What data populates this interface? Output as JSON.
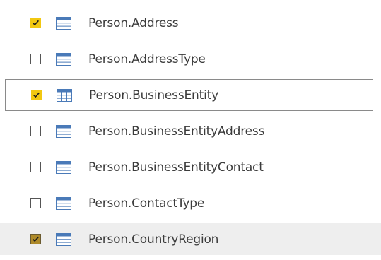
{
  "tables": [
    {
      "label": "Person.Address",
      "checked": true,
      "state": "normal"
    },
    {
      "label": "Person.AddressType",
      "checked": false,
      "state": "normal"
    },
    {
      "label": "Person.BusinessEntity",
      "checked": true,
      "state": "selected"
    },
    {
      "label": "Person.BusinessEntityAddress",
      "checked": false,
      "state": "normal"
    },
    {
      "label": "Person.BusinessEntityContact",
      "checked": false,
      "state": "normal"
    },
    {
      "label": "Person.ContactType",
      "checked": false,
      "state": "normal"
    },
    {
      "label": "Person.CountryRegion",
      "checked": true,
      "state": "hover"
    }
  ],
  "colors": {
    "check_fill": "#f2c811",
    "check_fill_hover": "#ae8a2a",
    "table_icon": "#4a7ab8",
    "text": "#3b3b3b"
  },
  "icons": {
    "checkbox": "checkbox-icon",
    "table": "table-icon"
  }
}
